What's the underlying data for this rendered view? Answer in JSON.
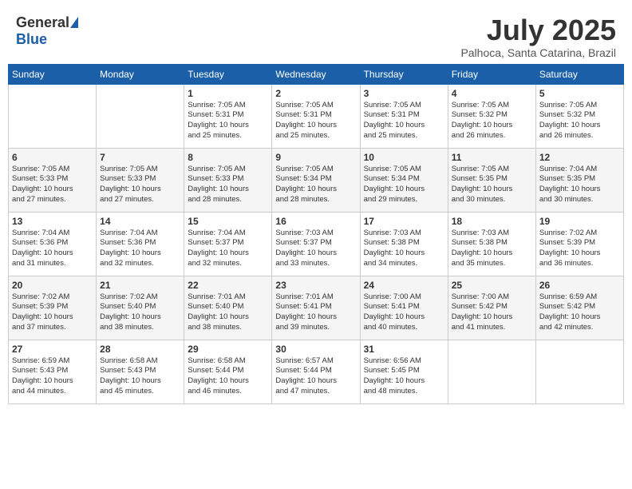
{
  "header": {
    "logo_general": "General",
    "logo_blue": "Blue",
    "month": "July 2025",
    "location": "Palhoca, Santa Catarina, Brazil"
  },
  "weekdays": [
    "Sunday",
    "Monday",
    "Tuesday",
    "Wednesday",
    "Thursday",
    "Friday",
    "Saturday"
  ],
  "weeks": [
    [
      {
        "day": "",
        "info": ""
      },
      {
        "day": "",
        "info": ""
      },
      {
        "day": "1",
        "info": "Sunrise: 7:05 AM\nSunset: 5:31 PM\nDaylight: 10 hours\nand 25 minutes."
      },
      {
        "day": "2",
        "info": "Sunrise: 7:05 AM\nSunset: 5:31 PM\nDaylight: 10 hours\nand 25 minutes."
      },
      {
        "day": "3",
        "info": "Sunrise: 7:05 AM\nSunset: 5:31 PM\nDaylight: 10 hours\nand 25 minutes."
      },
      {
        "day": "4",
        "info": "Sunrise: 7:05 AM\nSunset: 5:32 PM\nDaylight: 10 hours\nand 26 minutes."
      },
      {
        "day": "5",
        "info": "Sunrise: 7:05 AM\nSunset: 5:32 PM\nDaylight: 10 hours\nand 26 minutes."
      }
    ],
    [
      {
        "day": "6",
        "info": "Sunrise: 7:05 AM\nSunset: 5:33 PM\nDaylight: 10 hours\nand 27 minutes."
      },
      {
        "day": "7",
        "info": "Sunrise: 7:05 AM\nSunset: 5:33 PM\nDaylight: 10 hours\nand 27 minutes."
      },
      {
        "day": "8",
        "info": "Sunrise: 7:05 AM\nSunset: 5:33 PM\nDaylight: 10 hours\nand 28 minutes."
      },
      {
        "day": "9",
        "info": "Sunrise: 7:05 AM\nSunset: 5:34 PM\nDaylight: 10 hours\nand 28 minutes."
      },
      {
        "day": "10",
        "info": "Sunrise: 7:05 AM\nSunset: 5:34 PM\nDaylight: 10 hours\nand 29 minutes."
      },
      {
        "day": "11",
        "info": "Sunrise: 7:05 AM\nSunset: 5:35 PM\nDaylight: 10 hours\nand 30 minutes."
      },
      {
        "day": "12",
        "info": "Sunrise: 7:04 AM\nSunset: 5:35 PM\nDaylight: 10 hours\nand 30 minutes."
      }
    ],
    [
      {
        "day": "13",
        "info": "Sunrise: 7:04 AM\nSunset: 5:36 PM\nDaylight: 10 hours\nand 31 minutes."
      },
      {
        "day": "14",
        "info": "Sunrise: 7:04 AM\nSunset: 5:36 PM\nDaylight: 10 hours\nand 32 minutes."
      },
      {
        "day": "15",
        "info": "Sunrise: 7:04 AM\nSunset: 5:37 PM\nDaylight: 10 hours\nand 32 minutes."
      },
      {
        "day": "16",
        "info": "Sunrise: 7:03 AM\nSunset: 5:37 PM\nDaylight: 10 hours\nand 33 minutes."
      },
      {
        "day": "17",
        "info": "Sunrise: 7:03 AM\nSunset: 5:38 PM\nDaylight: 10 hours\nand 34 minutes."
      },
      {
        "day": "18",
        "info": "Sunrise: 7:03 AM\nSunset: 5:38 PM\nDaylight: 10 hours\nand 35 minutes."
      },
      {
        "day": "19",
        "info": "Sunrise: 7:02 AM\nSunset: 5:39 PM\nDaylight: 10 hours\nand 36 minutes."
      }
    ],
    [
      {
        "day": "20",
        "info": "Sunrise: 7:02 AM\nSunset: 5:39 PM\nDaylight: 10 hours\nand 37 minutes."
      },
      {
        "day": "21",
        "info": "Sunrise: 7:02 AM\nSunset: 5:40 PM\nDaylight: 10 hours\nand 38 minutes."
      },
      {
        "day": "22",
        "info": "Sunrise: 7:01 AM\nSunset: 5:40 PM\nDaylight: 10 hours\nand 38 minutes."
      },
      {
        "day": "23",
        "info": "Sunrise: 7:01 AM\nSunset: 5:41 PM\nDaylight: 10 hours\nand 39 minutes."
      },
      {
        "day": "24",
        "info": "Sunrise: 7:00 AM\nSunset: 5:41 PM\nDaylight: 10 hours\nand 40 minutes."
      },
      {
        "day": "25",
        "info": "Sunrise: 7:00 AM\nSunset: 5:42 PM\nDaylight: 10 hours\nand 41 minutes."
      },
      {
        "day": "26",
        "info": "Sunrise: 6:59 AM\nSunset: 5:42 PM\nDaylight: 10 hours\nand 42 minutes."
      }
    ],
    [
      {
        "day": "27",
        "info": "Sunrise: 6:59 AM\nSunset: 5:43 PM\nDaylight: 10 hours\nand 44 minutes."
      },
      {
        "day": "28",
        "info": "Sunrise: 6:58 AM\nSunset: 5:43 PM\nDaylight: 10 hours\nand 45 minutes."
      },
      {
        "day": "29",
        "info": "Sunrise: 6:58 AM\nSunset: 5:44 PM\nDaylight: 10 hours\nand 46 minutes."
      },
      {
        "day": "30",
        "info": "Sunrise: 6:57 AM\nSunset: 5:44 PM\nDaylight: 10 hours\nand 47 minutes."
      },
      {
        "day": "31",
        "info": "Sunrise: 6:56 AM\nSunset: 5:45 PM\nDaylight: 10 hours\nand 48 minutes."
      },
      {
        "day": "",
        "info": ""
      },
      {
        "day": "",
        "info": ""
      }
    ]
  ]
}
